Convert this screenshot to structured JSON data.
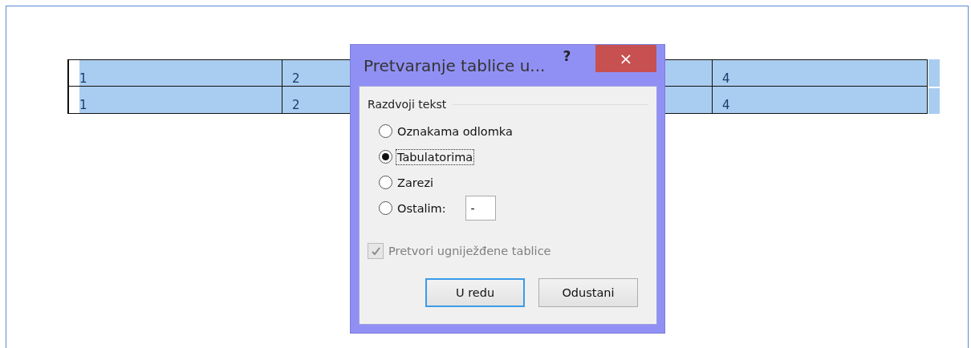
{
  "table": {
    "rows": [
      {
        "selected": true,
        "cells": [
          "1",
          "2",
          null,
          "4"
        ]
      },
      {
        "selected": true,
        "cells": [
          "1",
          "2",
          null,
          "4"
        ]
      }
    ]
  },
  "dialog": {
    "title": "Pretvaranje tablice u...",
    "help": "?",
    "close": "×",
    "group_label": "Razdvoji tekst",
    "options": [
      {
        "label": "Oznakama odlomka",
        "selected": false,
        "focused": false
      },
      {
        "label": "Tabulatorima",
        "selected": true,
        "focused": true
      },
      {
        "label": "Zarezi",
        "selected": false,
        "focused": false
      },
      {
        "label": "Ostalim:",
        "selected": false,
        "focused": false,
        "value": "-"
      }
    ],
    "nested": {
      "label": "Pretvori ugniježđene tablice",
      "checked": true,
      "disabled": true
    },
    "buttons": [
      {
        "label": "U redu",
        "default": true
      },
      {
        "label": "Odustani",
        "default": false
      }
    ]
  }
}
